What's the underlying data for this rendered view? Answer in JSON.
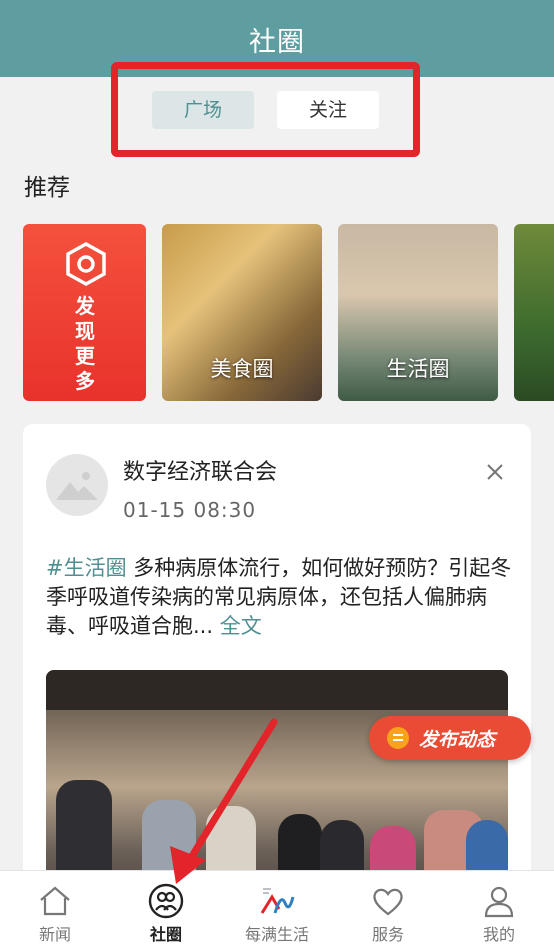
{
  "header": {
    "title": "社圈"
  },
  "tabs": [
    {
      "label": "广场",
      "active": true
    },
    {
      "label": "关注",
      "active": false
    }
  ],
  "section": {
    "title": "推荐"
  },
  "circles": [
    {
      "label": "发现更多",
      "icon": "hexagon-target-icon"
    },
    {
      "label": "美食圈"
    },
    {
      "label": "生活圈"
    },
    {
      "label": ""
    }
  ],
  "post": {
    "author": "数字经济联合会",
    "time": "01-15  08:30",
    "tag": "#生活圈",
    "text": " 多种病原体流行，如何做好预防？引起冬季呼吸道传染病的常见病原体，还包括人偏肺病毒、呼吸道合胞...",
    "more": " 全文"
  },
  "publish": {
    "label": "发布动态"
  },
  "tabbar": [
    {
      "label": "新闻",
      "icon": "home-icon"
    },
    {
      "label": "社圈",
      "icon": "community-icon",
      "active": true
    },
    {
      "label": "每满生活",
      "icon": "brand-logo-icon"
    },
    {
      "label": "服务",
      "icon": "heart-icon"
    },
    {
      "label": "我的",
      "icon": "person-icon"
    }
  ],
  "colors": {
    "brand": "#5f9ea0",
    "highlight": "#e3242b",
    "accent": "#e94b35"
  }
}
